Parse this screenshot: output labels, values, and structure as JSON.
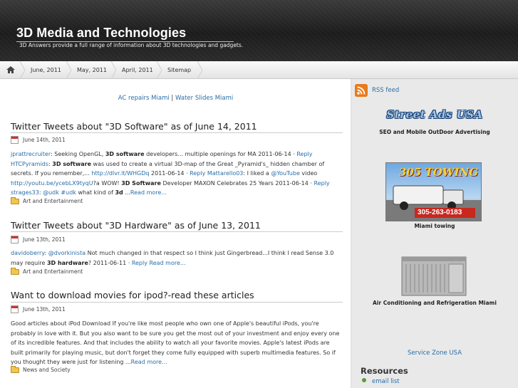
{
  "header": {
    "title": "3D Media and Technologies",
    "description": "3D Answers provide a full range of information about 3D technologies and gadgets."
  },
  "nav": {
    "home_icon": "home-icon",
    "items": [
      "June, 2011",
      "May, 2011",
      "April, 2011",
      "Sitemap"
    ]
  },
  "top_links": {
    "link1": "AC repairs Miami",
    "separator": "|",
    "link2": "Water Slides Miami"
  },
  "posts": [
    {
      "title": "Twitter Tweets about \"3D Software\" as of June 14, 2011",
      "date": "June 14th, 2011",
      "category": "Art and Entertainment"
    },
    {
      "title": "Twitter Tweets about \"3D Hardware\" as of June 13, 2011",
      "date": "June 13th, 2011",
      "category": "Art and Entertainment"
    },
    {
      "title": "Want to download movies for ipod?-read these articles",
      "date": "June 13th, 2011",
      "category": "News and Society"
    }
  ],
  "post1_body": {
    "u1": "jprattrecruiter",
    "t1": ": Seeking OpenGL, ",
    "b1": "3D software",
    "t2": " developers... multiple openings for MA 2011-06-14 · ",
    "reply1": "Reply",
    "u2": "HTCPyramids",
    "t3": ": ",
    "b2": "3D software",
    "t4": " was used to create a virtual 3D-map of the Great _Pyramid's_ hidden chamber of secrets. If you remember,... ",
    "link1": "http://dlvr.it/WHGDq",
    "t5": " 2011-06-14 · ",
    "reply2": "Reply",
    "u3": "Mattarello03",
    "t6": ": I liked a ",
    "yt": "@YouTube",
    "t7": " video ",
    "link2": "http://youtu.be/ycebLX9tyqU",
    "t8": "?a WOW! ",
    "b3": "3D Software",
    "t9": " Developer MAXON Celebrates 25 Years 2011-06-14 · ",
    "reply3": "Reply",
    "u4": "strages33",
    "t10": ": ",
    "udk1": "@udk",
    "t11": " ",
    "udk2": "#udk",
    "t12": " what kind of ",
    "b4": "3d",
    "t13": " ...",
    "more": "Read more..."
  },
  "post2_body": {
    "u1": "davidoberry",
    "t1": ": ",
    "u2": "@dvorkinista",
    "t2": " Not much changed in that respect so I think just Gingerbread...I think I read Sense 3.0 may require ",
    "b1": "3D hardware",
    "t3": "? 2011-06-11 · ",
    "reply": "Reply",
    "more": "Read more..."
  },
  "post3_body": {
    "text": "Good articles about iPod Download If you're like most people who own one of Apple's beautiful iPods, you're probably in love with it. But you also want to be sure you get the most out of your investment and enjoy every one of its incredible features. And that includes the ability to watch all your favorite movies. Apple's latest iPods are built primarily for playing music, but don't forget they come fully equipped with superb multimedia features. So if you thought they were just for listening ...",
    "more": "Read more..."
  },
  "sidebar": {
    "rss_label": "RSS feed",
    "ad1_logo": "Street Ads USA",
    "ad1_caption": "SEO and Mobile OutDoor Advertising",
    "ad2_logo": "305 TOWING",
    "ad2_phone": "305-263-0183",
    "ad2_caption": "Miami towing",
    "ad3_caption": "Air Conditioning and Refrigeration Miami",
    "service_zone": "Service Zone USA",
    "resources_heading": "Resources",
    "resources_items": [
      "email list"
    ]
  },
  "colors": {
    "link": "#2a6da8",
    "header_bg": "#222222",
    "sidebar_bg": "#e9e9e9",
    "rss_orange": "#e97a1b"
  }
}
